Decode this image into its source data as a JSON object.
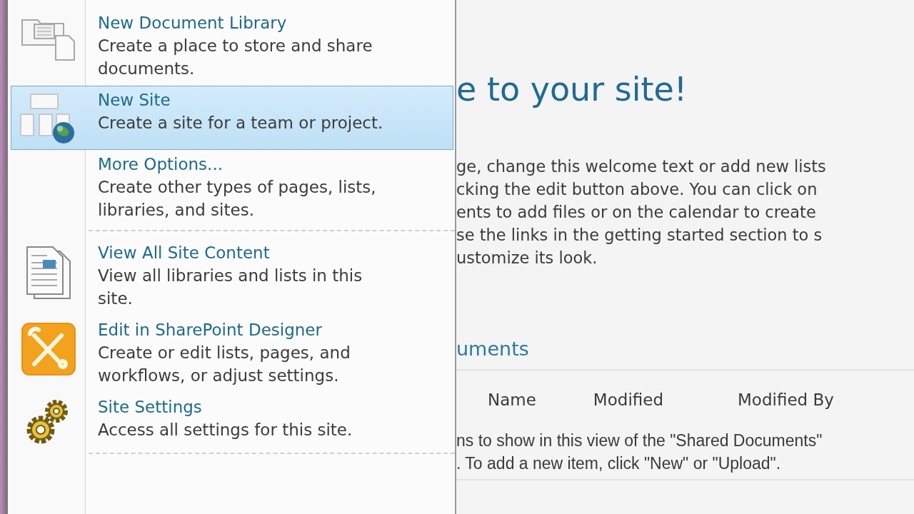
{
  "menu": {
    "items": [
      {
        "title": "New Document Library",
        "description": "Create a place to store and share documents.",
        "selected": false,
        "separator_after": false
      },
      {
        "title": "New Site",
        "description": "Create a site for a team or project.",
        "selected": true,
        "separator_after": false
      },
      {
        "title": "More Options...",
        "description": "Create other types of pages, lists, libraries, and sites.",
        "selected": false,
        "separator_after": true
      },
      {
        "title": "View All Site Content",
        "description": "View all libraries and lists in this site.",
        "selected": false,
        "separator_after": false
      },
      {
        "title": "Edit in SharePoint Designer",
        "description": "Create or edit lists, pages, and workflows, or adjust settings.",
        "selected": false,
        "separator_after": false
      },
      {
        "title": "Site Settings",
        "description": "Access all settings for this site.",
        "selected": false,
        "separator_after": true
      }
    ]
  },
  "page": {
    "heading": "e to your site!",
    "welcome_lines": [
      "ge, change this welcome text or add new lists",
      "cking the edit button above. You can click on",
      "ents to add files or on the calendar to create",
      "se the links in the getting started section to s",
      "ustomize its look."
    ],
    "section_title": "uments",
    "table": {
      "columns": [
        "Name",
        "Modified",
        "Modified By"
      ],
      "empty_lines": [
        "ns to show in this view of the \"Shared Documents\"",
        ". To add a new item, click \"New\" or \"Upload\"."
      ]
    }
  }
}
